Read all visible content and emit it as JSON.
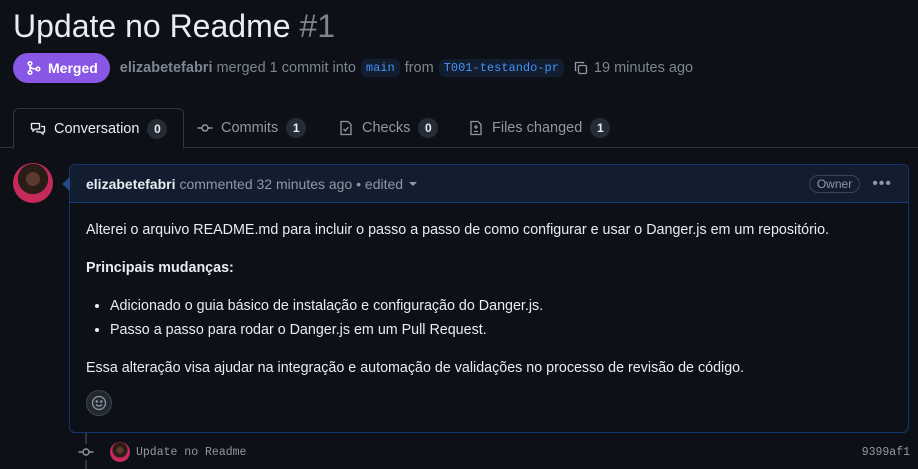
{
  "pr": {
    "title": "Update no Readme",
    "number": "#1",
    "state_label": "Merged",
    "author": "elizabetefabri",
    "merge_text": "merged 1 commit into",
    "base_branch": "main",
    "from_text": "from",
    "head_branch": "T001-testando-pr",
    "time_ago": "19 minutes ago"
  },
  "tabs": [
    {
      "label": "Conversation",
      "count": "0",
      "icon": "comment-discussion-icon",
      "active": true
    },
    {
      "label": "Commits",
      "count": "1",
      "icon": "git-commit-icon"
    },
    {
      "label": "Checks",
      "count": "0",
      "icon": "checklist-icon"
    },
    {
      "label": "Files changed",
      "count": "1",
      "icon": "file-diff-icon"
    }
  ],
  "comment": {
    "author": "elizabetefabri",
    "meta": "commented 32 minutes ago • edited",
    "role_badge": "Owner",
    "body": {
      "intro": "Alterei o arquivo README.md para incluir o passo a passo de como configurar e usar o Danger.js em um repositório.",
      "heading": "Principais mudanças:",
      "bullets": [
        "Adicionado o guia básico de instalação e configuração do Danger.js.",
        "Passo a passo para rodar o Danger.js em um Pull Request."
      ],
      "outro": "Essa alteração visa ajudar na integração e automação de validações no processo de revisão de código."
    }
  },
  "commit": {
    "message": "Update no Readme",
    "sha": "9399af1"
  },
  "colors": {
    "background": "#0d1117",
    "merged": "#8957e5",
    "branch_text": "#4493f8",
    "border": "#30363d"
  }
}
